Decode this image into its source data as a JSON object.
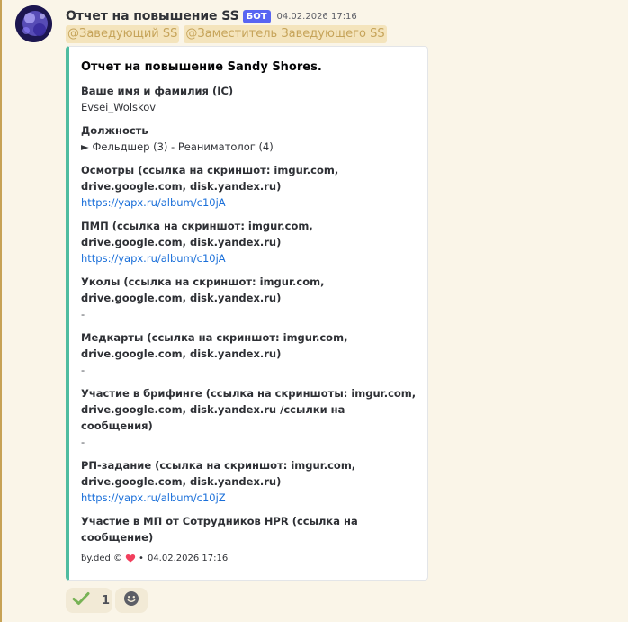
{
  "message": {
    "author": "Отчет на повышение SS",
    "bot_tag": "БОТ",
    "timestamp": "04.02.2026 17:16",
    "mentions": [
      "@Заведующий SS",
      "@Заместитель Заведующего SS"
    ]
  },
  "embed": {
    "accent_color": "#4fbca0",
    "title": "Отчет на повышение Sandy Shores.",
    "fields": [
      {
        "name": "Ваше имя и фамилия (IC)",
        "value": "Evsei_Wolskov",
        "kind": "text"
      },
      {
        "name": "Должность",
        "value": "► Фельдшер (3) - Реаниматолог (4)",
        "kind": "text"
      },
      {
        "name": "Осмотры (ссылка на скриншот: imgur.com, drive.google.com, disk.yandex.ru)",
        "value": "https://yapx.ru/album/c10jA",
        "kind": "link"
      },
      {
        "name": "ПМП (ссылка на скриншот: imgur.com, drive.google.com, disk.yandex.ru)",
        "value": "https://yapx.ru/album/c10jA",
        "kind": "link"
      },
      {
        "name": "Уколы (ссылка на скриншот: imgur.com, drive.google.com, disk.yandex.ru)",
        "value": "-",
        "kind": "dash"
      },
      {
        "name": "Медкарты (ссылка на скриншот: imgur.com, drive.google.com, disk.yandex.ru)",
        "value": "-",
        "kind": "dash"
      },
      {
        "name": "Участие в брифинге (ссылка на скриншоты: imgur.com, drive.google.com, disk.yandex.ru /ссылки на сообщения)",
        "value": "-",
        "kind": "dash"
      },
      {
        "name": "РП-задание   (ссылка на скриншот: imgur.com, drive.google.com, disk.yandex.ru)",
        "value": "https://yapx.ru/album/c10jZ",
        "kind": "link"
      },
      {
        "name": "Участие в МП от Сотрудников HPR (ссылка на сообщение)",
        "value": "-",
        "kind": "dash"
      }
    ],
    "footer": {
      "text": "by.ded ©",
      "separator": "•",
      "timestamp": "04.02.2026 17:16",
      "icon": "heart-icon"
    }
  },
  "reactions": [
    {
      "icon": "check-icon",
      "count": "1"
    },
    {
      "icon": "add-reaction-icon"
    }
  ]
}
